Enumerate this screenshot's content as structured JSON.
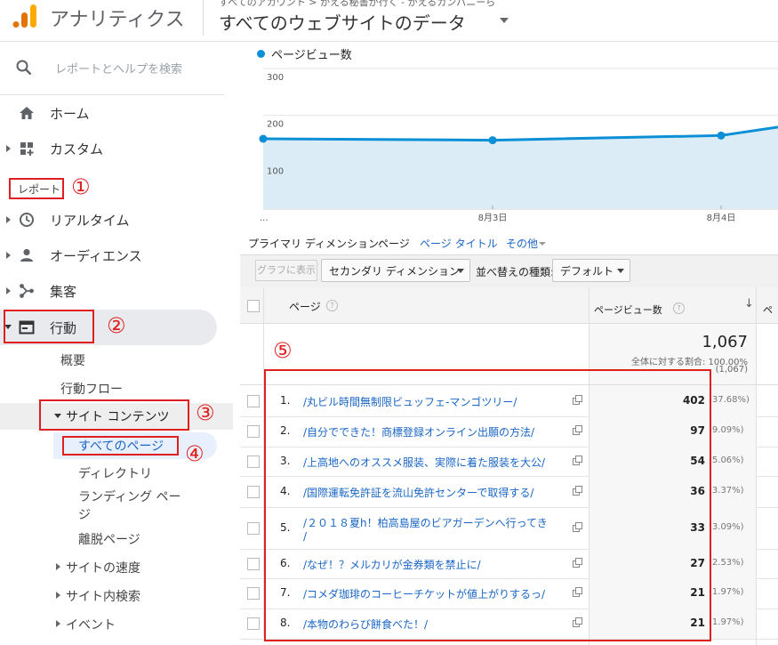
{
  "header": {
    "app_name": "アナリティクス",
    "breadcrumb": "すべてのアカウント > かえる秘書が行く - かえるカンパニーら",
    "view_name": "すべてのウェブサイトのデータ"
  },
  "sidebar": {
    "search_placeholder": "レポートとヘルプを検索",
    "home": "ホーム",
    "custom": "カスタム",
    "reports_heading": "レポート",
    "realtime": "リアルタイム",
    "audience": "オーディエンス",
    "acquisition": "集客",
    "behavior": "行動",
    "behavior_sub": {
      "overview": "概要",
      "flow": "行動フロー",
      "site_content": "サイト コンテンツ",
      "all_pages": "すべてのページ",
      "directory": "ディレクトリ",
      "landing_pages_1": "ランディング ペー",
      "landing_pages_2": "ジ",
      "exit_pages": "離脱ページ",
      "site_speed": "サイトの速度",
      "site_search": "サイト内検索",
      "events": "イベント"
    }
  },
  "annotations": [
    "①",
    "②",
    "③",
    "④",
    "⑤"
  ],
  "colors": {
    "accent": "#0b8fd6",
    "annotation": "#e02020",
    "link": "#1a66c6"
  },
  "chart_data": {
    "type": "area",
    "legend": "ページビュー数",
    "y_ticks": [
      "300",
      "200",
      "100"
    ],
    "ylim": [
      0,
      300
    ],
    "x_ticks": [
      "...",
      "8月3日",
      "8月4日"
    ],
    "points": [
      {
        "x": "8月2日",
        "y": 150
      },
      {
        "x": "8月3日",
        "y": 147
      },
      {
        "x": "8月4日",
        "y": 157
      },
      {
        "x": "8月5日",
        "y": 175
      }
    ]
  },
  "dimension_bar": {
    "label": "プライマリ ディメンション:",
    "page": "ページ",
    "page_title": "ページ タイトル",
    "other": "その他"
  },
  "toolbar": {
    "graph_button": "グラフに表示",
    "secondary_dimension": "セカンダリ ディメンション",
    "sort_label": "並べ替えの種類:",
    "sort_value": "デフォルト"
  },
  "table": {
    "col_page": "ページ",
    "col_pageviews": "ページビュー数",
    "col_next_partial": "ペ",
    "total_value": "1,067",
    "total_pct_text": "全体に対する割合: 100.00%",
    "total_paren": "(1,067)",
    "rows": [
      {
        "num": "1.",
        "page": "/丸ビル時間無制限ビュッフェ-マンゴツリー/",
        "value": "402",
        "pct": "(37.68%)"
      },
      {
        "num": "2.",
        "page": "/自分でできた！商標登録オンライン出願の方法/",
        "value": "97",
        "pct": "(9.09%)"
      },
      {
        "num": "3.",
        "page": "/上高地へのオススメ服装、実際に着た服装を大公/",
        "value": "54",
        "pct": "(5.06%)"
      },
      {
        "num": "4.",
        "page": "/国際運転免許証を流山免許センターで取得する/",
        "value": "36",
        "pct": "(3.37%)"
      },
      {
        "num": "5.",
        "page": "/２０１８夏h！柏高島屋のビアガーデンへ行ってき",
        "page_line2": "/",
        "value": "33",
        "pct": "(3.09%)"
      },
      {
        "num": "6.",
        "page": "/なぜ！？メルカリが金券類を禁止に/",
        "value": "27",
        "pct": "(2.53%)"
      },
      {
        "num": "7.",
        "page": "/コメダ珈琲のコーヒーチケットが値上がりするっ/",
        "value": "21",
        "pct": "(1.97%)"
      },
      {
        "num": "8.",
        "page": "/本物のわらび餅食べた！/",
        "value": "21",
        "pct": "(1.97%)"
      }
    ]
  }
}
